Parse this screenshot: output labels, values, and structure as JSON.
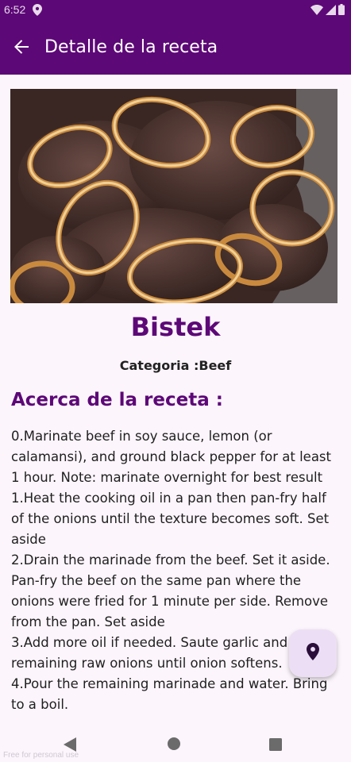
{
  "status_bar": {
    "time": "6:52",
    "icons": [
      "location-icon",
      "wifi-icon",
      "signal-icon",
      "battery-icon"
    ]
  },
  "app_bar": {
    "title": "Detalle de la receta",
    "back_icon": "arrow-left-icon"
  },
  "recipe": {
    "name": "Bistek",
    "category": "Categoria :Beef",
    "about_heading": "Acerca de la receta :",
    "instructions": "0.Marinate beef in soy sauce, lemon (or calamansi), and ground black pepper for at least 1 hour. Note: marinate overnight for best result\n1.Heat the cooking oil in a pan then pan-fry half of the onions until the texture becomes soft. Set aside\n2.Drain the marinade from the beef. Set it aside. Pan-fry the beef on the same pan where the onions were fried for 1 minute per side. Remove from the pan. Set aside\n3.Add more oil if needed. Saute garlic and remaining raw onions until onion softens.\n4.Pour the remaining marinade and water. Bring to a boil."
  },
  "fab": {
    "icon": "location-pin-icon"
  },
  "nav_bar": {
    "icons": [
      "nav-back-icon",
      "nav-home-icon",
      "nav-recents-icon"
    ]
  },
  "watermark": "Free for personal use",
  "colors": {
    "primary": "#5d0877",
    "background": "#fcf5fc",
    "fab_background": "#ecdff5"
  }
}
